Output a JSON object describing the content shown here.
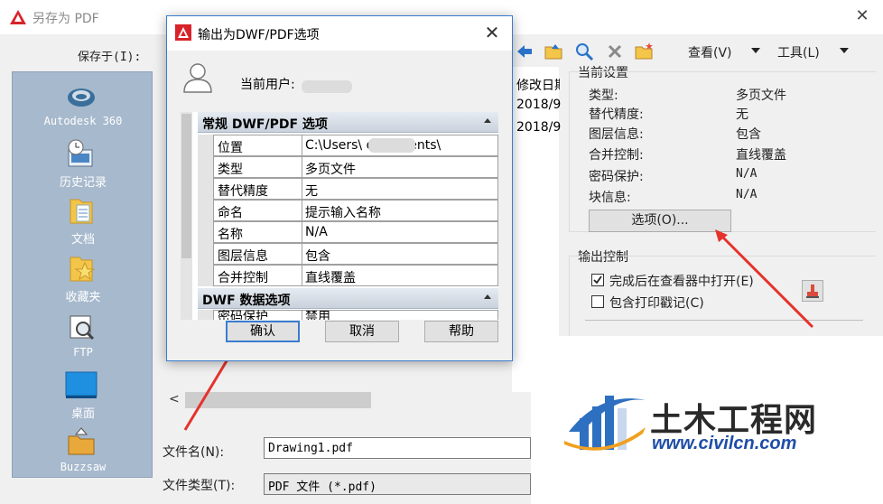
{
  "window": {
    "title": "另存为 PDF"
  },
  "save_in_label": "保存于(I):",
  "places": [
    {
      "label": "Autodesk 360",
      "icon": "autodesk360-icon"
    },
    {
      "label": "历史记录",
      "icon": "history-icon"
    },
    {
      "label": "文档",
      "icon": "documents-icon"
    },
    {
      "label": "收藏夹",
      "icon": "favorites-icon"
    },
    {
      "label": "FTP",
      "icon": "ftp-icon"
    },
    {
      "label": "桌面",
      "icon": "desktop-icon"
    },
    {
      "label": "Buzzsaw",
      "icon": "buzzsaw-icon"
    }
  ],
  "toolbar": {
    "view_label": "查看(V)",
    "tools_label": "工具(L)"
  },
  "filelist": {
    "header": "修改日期",
    "rows": [
      "2018/9",
      "2018/9"
    ]
  },
  "current_settings": {
    "title": "当前设置",
    "items": [
      {
        "key": "类型:",
        "value": "多页文件"
      },
      {
        "key": "替代精度:",
        "value": "无"
      },
      {
        "key": "图层信息:",
        "value": "包含"
      },
      {
        "key": "合并控制:",
        "value": "直线覆盖"
      },
      {
        "key": "密码保护:",
        "value": "N/A"
      },
      {
        "key": "块信息:",
        "value": "N/A"
      }
    ],
    "options_button": "选项(O)..."
  },
  "output_control": {
    "title": "输出控制",
    "open_in_viewer": {
      "label": "完成后在查看器中打开(E)",
      "checked": true
    },
    "include_stamp": {
      "label": "包含打印戳记(C)",
      "checked": false
    }
  },
  "file_name": {
    "label": "文件名(N):",
    "value": "Drawing1.pdf"
  },
  "file_type": {
    "label": "文件类型(T):",
    "value": "PDF 文件 (*.pdf)"
  },
  "dialog": {
    "title": "输出为DWF/PDF选项",
    "user_label": "当前用户:",
    "categories": [
      {
        "name": "常规 DWF/PDF 选项",
        "rows": [
          {
            "key": "位置",
            "value": "C:\\Users\\        documents\\"
          },
          {
            "key": "类型",
            "value": "多页文件"
          },
          {
            "key": "替代精度",
            "value": "无"
          },
          {
            "key": "命名",
            "value": "提示输入名称"
          },
          {
            "key": "名称",
            "value": "N/A"
          },
          {
            "key": "图层信息",
            "value": "包含"
          },
          {
            "key": "合并控制",
            "value": "直线覆盖"
          }
        ]
      },
      {
        "name": "DWF 数据选项",
        "rows": [
          {
            "key": "密码保护",
            "value": "禁用"
          }
        ]
      }
    ],
    "ok_button": "确认",
    "cancel_button": "取消",
    "help_button": "帮助"
  },
  "watermark": {
    "text": "土木工程网",
    "url": "www.civilcn.com"
  },
  "colors": {
    "accent": "#3b7ccf",
    "sidebar": "#a7b9cd",
    "arrow": "#e5322a"
  }
}
